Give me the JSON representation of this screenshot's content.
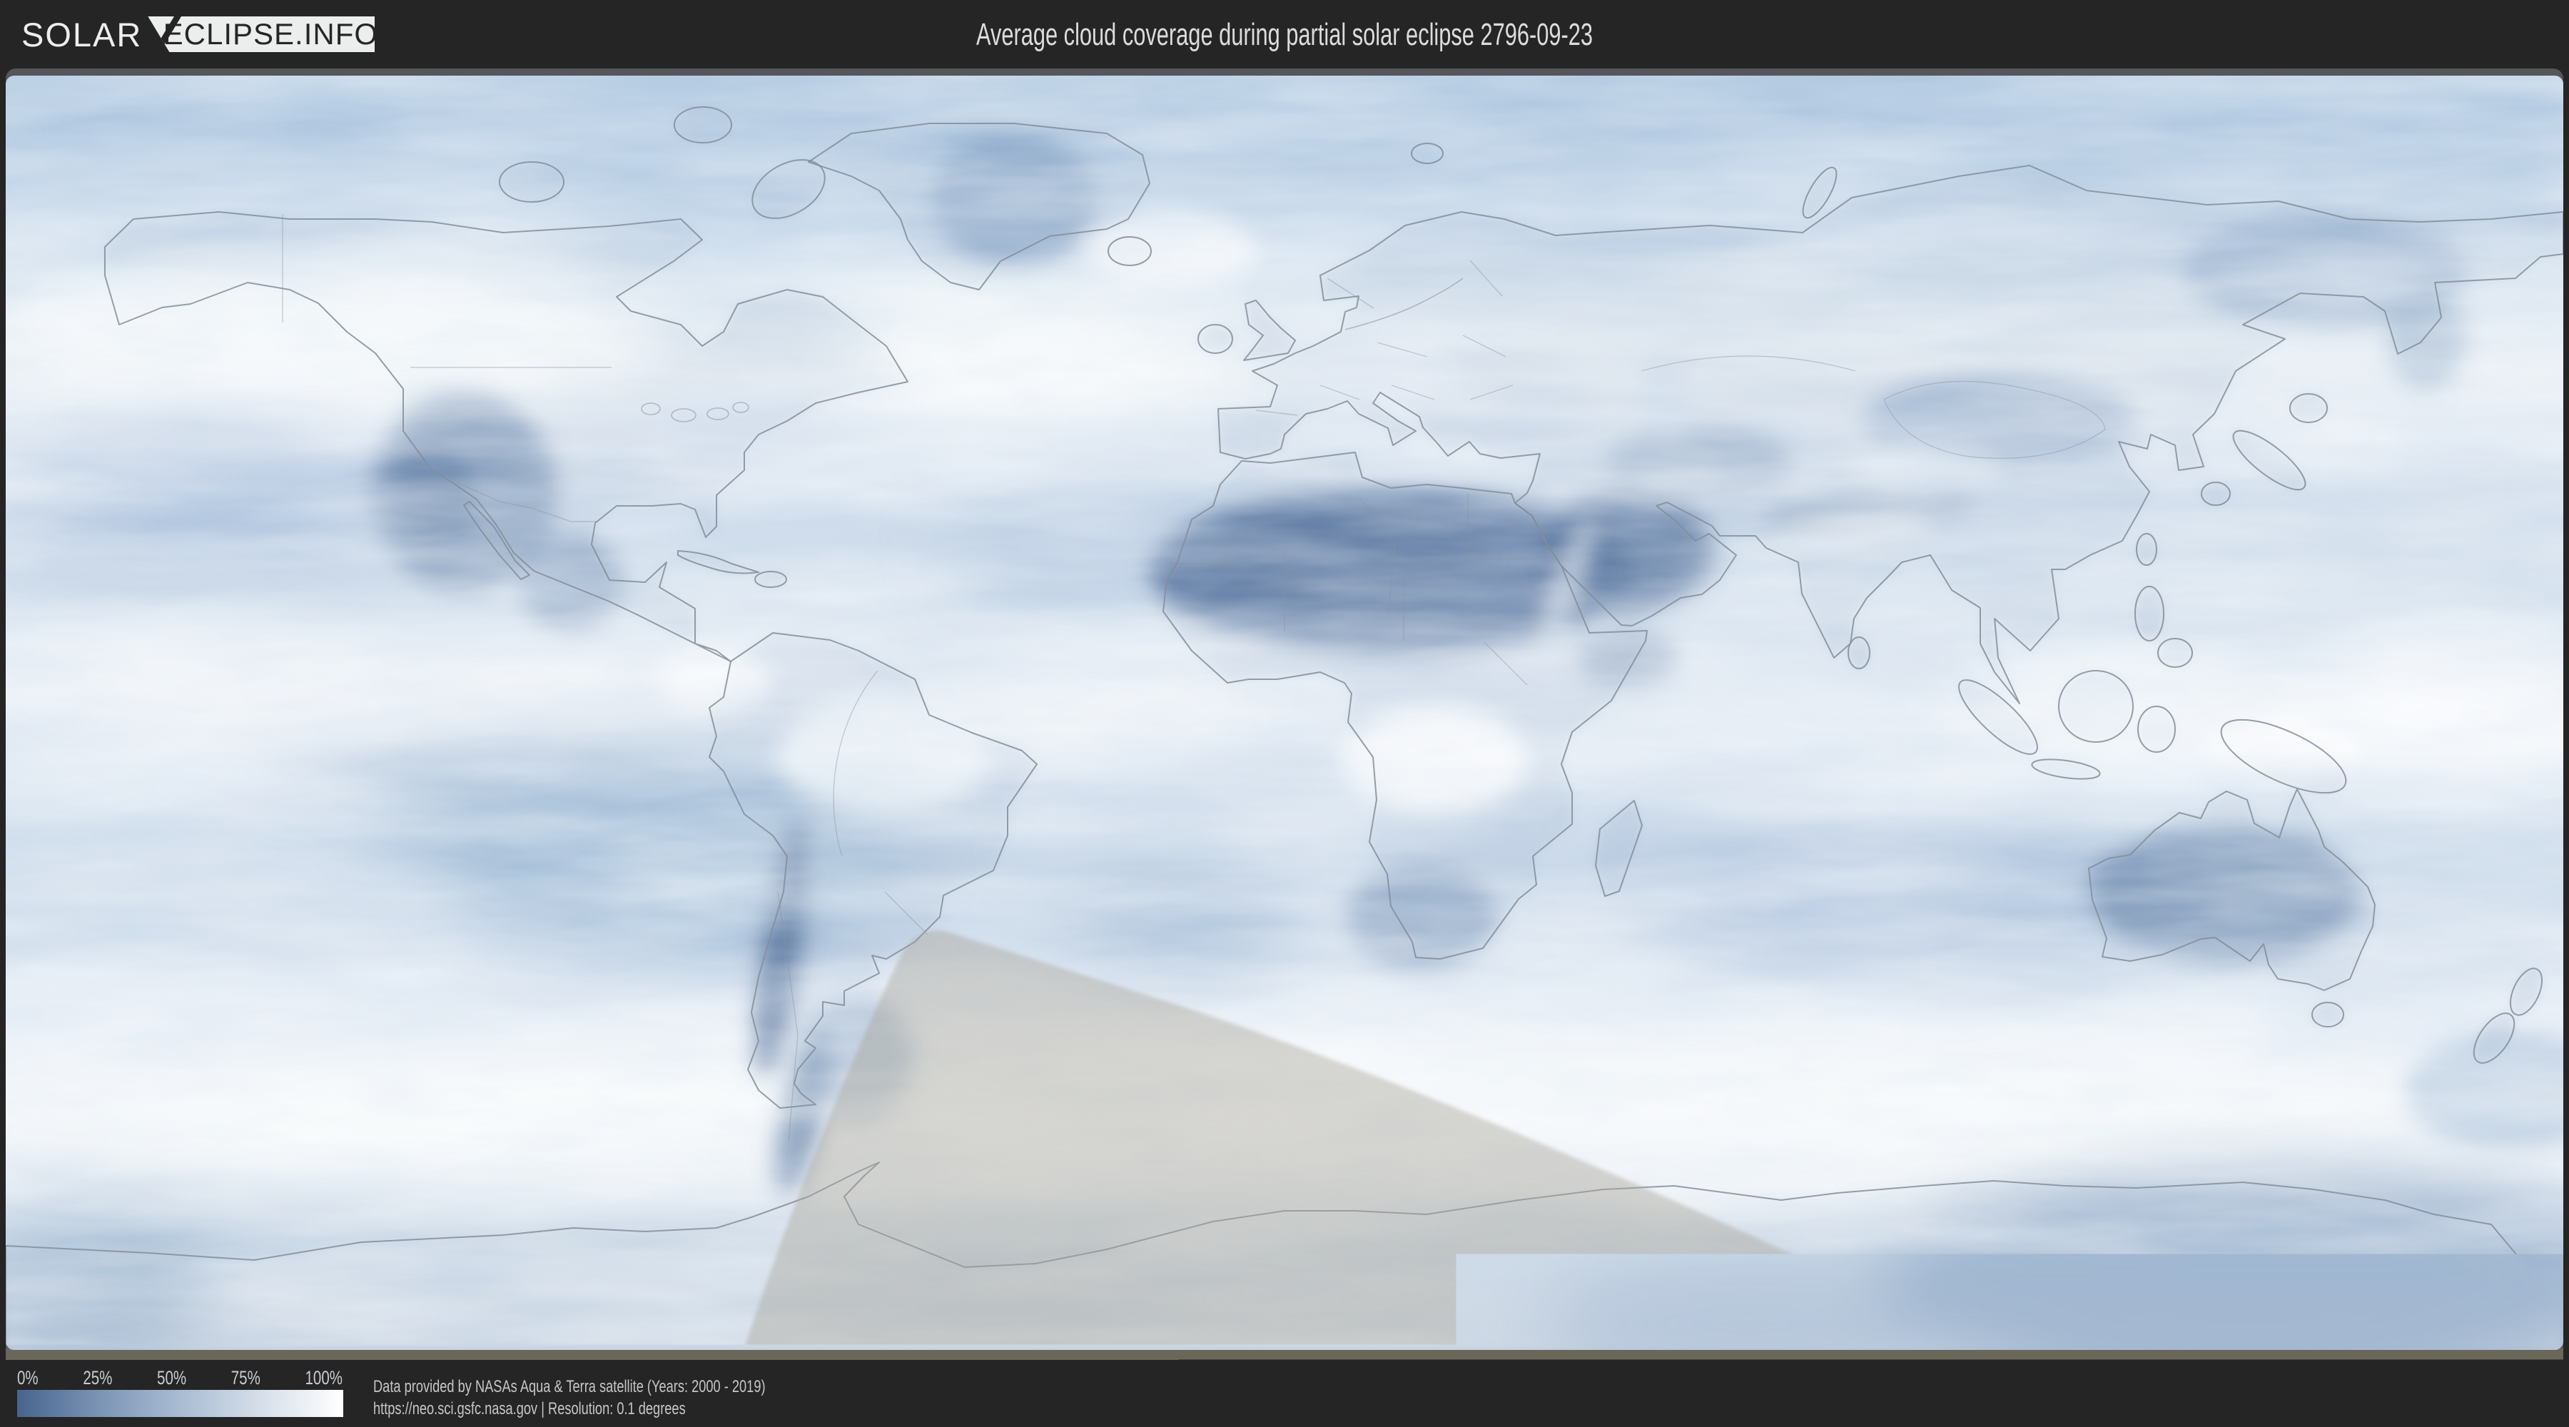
{
  "header": {
    "logo_prefix": "SOLAR",
    "logo_suffix": "ECLIPSE.INFO",
    "title": "Average cloud coverage during partial solar eclipse 2796-09-23"
  },
  "map": {
    "description": "World map (equirectangular) of average cloud coverage; darker blue = less cloud, white = full cloud; gray penumbral eclipse shadow over southern South America, South Atlantic and Antarctica",
    "shadow_color": "#a8a296",
    "shadow_opacity": 0.42
  },
  "legend": {
    "labels": [
      "0%",
      "25%",
      "50%",
      "75%",
      "100%"
    ],
    "gradient": [
      "#47648e",
      "#7b94b5",
      "#a9bcd3",
      "#d6dfe9",
      "#ffffff"
    ]
  },
  "footer": {
    "credit_line1": "Data provided by NASAs Aqua & Terra satellite (Years: 2000 - 2019)",
    "credit_line2": "https://neo.sci.gsfc.nasa.gov | Resolution: 0.1 degrees"
  }
}
